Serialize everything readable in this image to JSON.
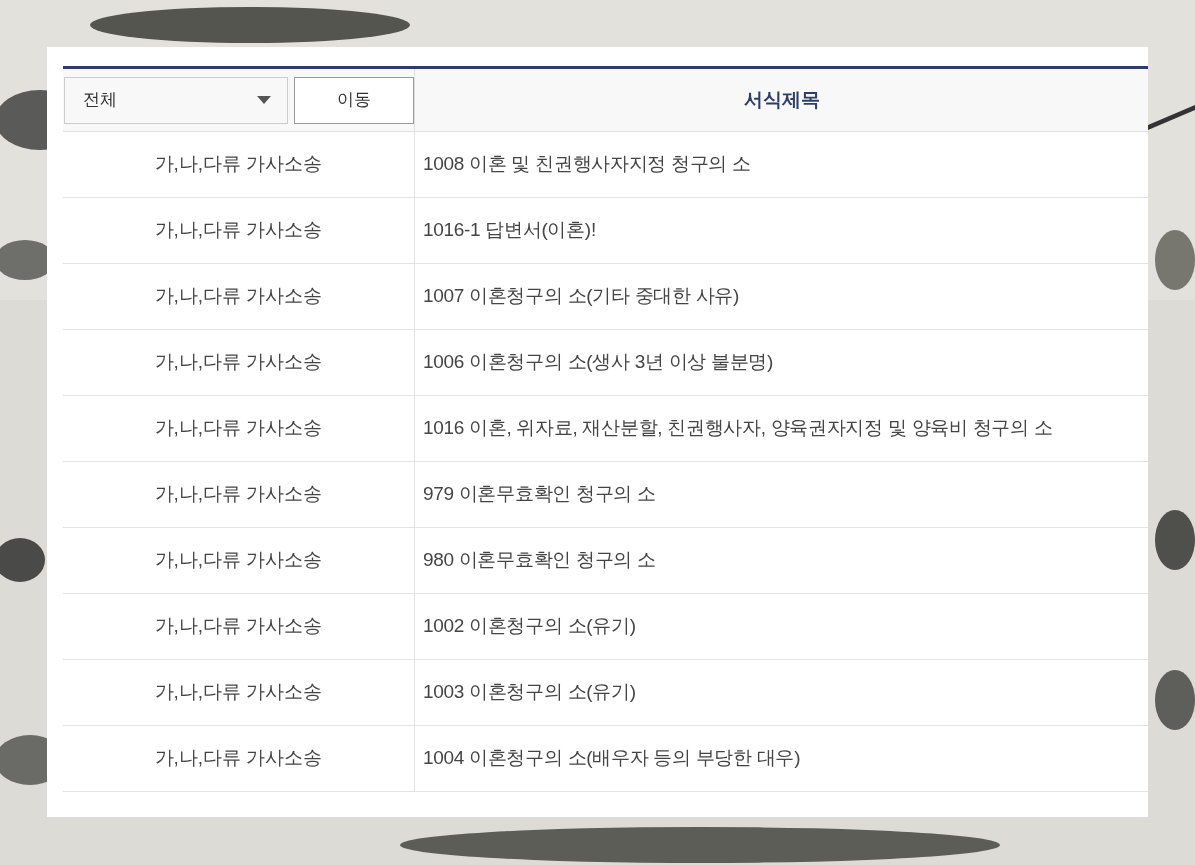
{
  "filter": {
    "select_value": "전체",
    "button": "이동"
  },
  "table": {
    "columns": [
      "서식제목"
    ],
    "rows": [
      {
        "category": "가,나,다류 가사소송",
        "title": "1008 이혼 및 친권행사자지정 청구의 소"
      },
      {
        "category": "가,나,다류 가사소송",
        "title": "1016-1 답변서(이혼)!"
      },
      {
        "category": "가,나,다류 가사소송",
        "title": "1007 이혼청구의 소(기타 중대한 사유)"
      },
      {
        "category": "가,나,다류 가사소송",
        "title": "1006 이혼청구의 소(생사 3년 이상 불분명)"
      },
      {
        "category": "가,나,다류 가사소송",
        "title": "1016 이혼, 위자료, 재산분할, 친권행사자, 양육권자지정 및 양육비 청구의 소"
      },
      {
        "category": "가,나,다류 가사소송",
        "title": "979 이혼무효확인 청구의 소"
      },
      {
        "category": "가,나,다류 가사소송",
        "title": "980 이혼무효확인 청구의 소"
      },
      {
        "category": "가,나,다류 가사소송",
        "title": "1002 이혼청구의 소(유기)"
      },
      {
        "category": "가,나,다류 가사소송",
        "title": "1003 이혼청구의 소(유기)"
      },
      {
        "category": "가,나,다류 가사소송",
        "title": "1004 이혼청구의 소(배우자 등의 부당한 대우)"
      }
    ]
  }
}
